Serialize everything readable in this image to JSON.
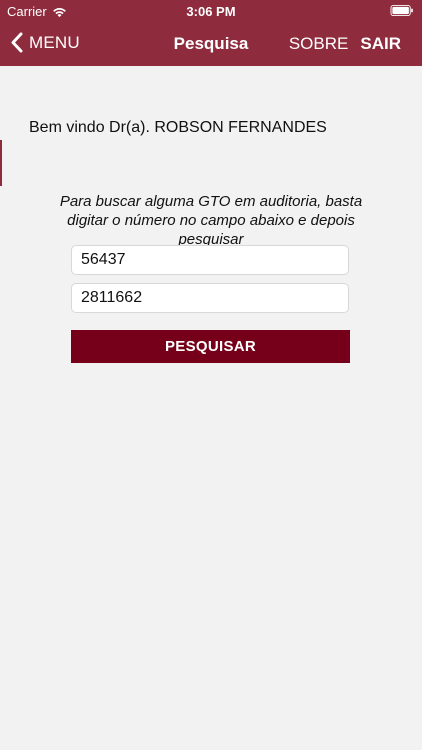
{
  "status_bar": {
    "carrier": "Carrier",
    "time": "3:06 PM"
  },
  "nav": {
    "back_label": "MENU",
    "title": "Pesquisa",
    "about_label": "SOBRE",
    "logout_label": "SAIR"
  },
  "main": {
    "welcome_text": "Bem vindo Dr(a). ROBSON FERNANDES",
    "instructions": "Para buscar alguma GTO em auditoria, basta digitar o número no campo abaixo e depois pesquisar",
    "field1_value": "56437",
    "field2_value": "2811662",
    "search_button_label": "PESQUISAR"
  },
  "colors": {
    "brand": "#8e2b3d",
    "button": "#760019",
    "background": "#f2f2f2"
  },
  "icons": {
    "back": "chevron-left-icon",
    "wifi": "wifi-icon",
    "battery": "battery-icon"
  }
}
